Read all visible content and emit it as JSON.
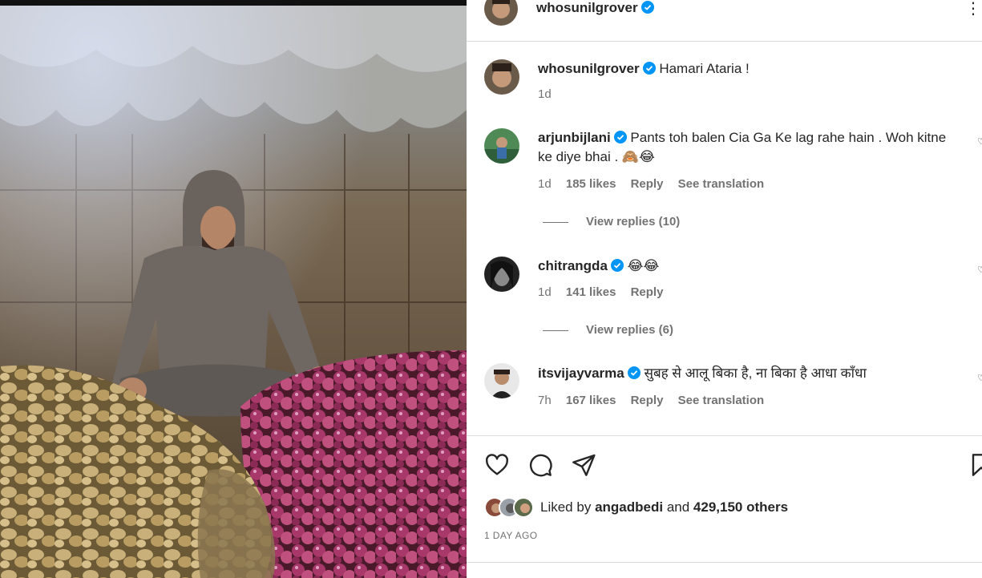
{
  "post": {
    "author": "whosunilgrover",
    "caption": "Hamari Ataria !",
    "caption_time": "1d"
  },
  "comments": [
    {
      "user": "arjunbijlani",
      "text": "Pants toh balen Cia Ga Ke lag rahe hain . Woh kitne ke diye bhai . 🙈😂",
      "time": "1d",
      "likes": "185 likes",
      "reply": "Reply",
      "translation": "See translation",
      "view_replies": "View replies (10)"
    },
    {
      "user": "chitrangda",
      "text": "😂😂",
      "time": "1d",
      "likes": "141 likes",
      "reply": "Reply",
      "view_replies": "View replies (6)"
    },
    {
      "user": "itsvijayvarma",
      "text": "सुबह से आलू बिका है, ना बिका है आधा काँधा",
      "time": "7h",
      "likes": "167 likes",
      "reply": "Reply",
      "translation": "See translation"
    }
  ],
  "engagement": {
    "liked_by_prefix": "Liked by",
    "liked_by_user": "angadbedi",
    "liked_by_and": "and",
    "others": "429,150 others",
    "time_ago": "1 DAY AGO"
  },
  "icons": [
    "heart-icon",
    "comment-icon",
    "share-icon",
    "bookmark-icon",
    "verified-badge-icon",
    "more-options-icon"
  ],
  "colors": {
    "verified": "#0095f6",
    "muted": "#737373",
    "text": "#262626",
    "divider": "#dbdbdb"
  }
}
